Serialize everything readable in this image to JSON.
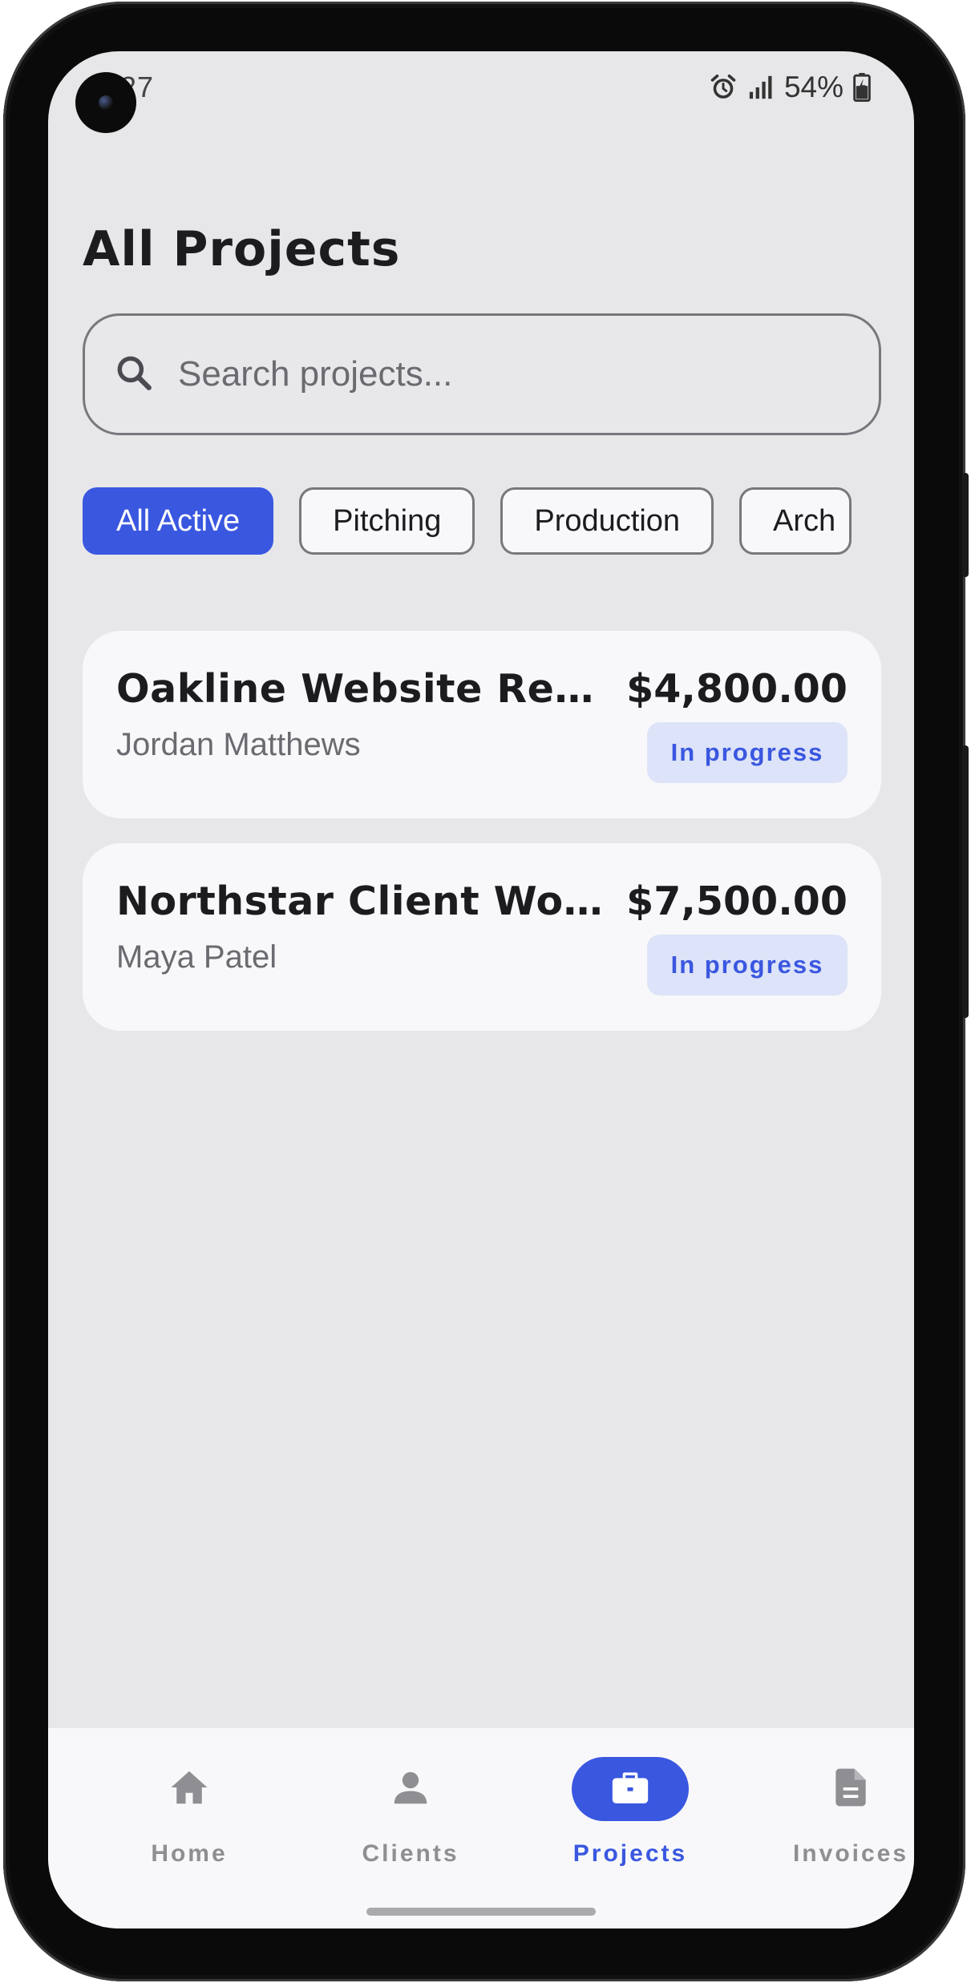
{
  "status_bar": {
    "time": "9:27",
    "battery": "54%"
  },
  "page": {
    "title": "All Projects"
  },
  "search": {
    "placeholder": "Search projects..."
  },
  "filters": [
    {
      "label": "All Active",
      "selected": true
    },
    {
      "label": "Pitching",
      "selected": false
    },
    {
      "label": "Production",
      "selected": false
    },
    {
      "label": "Arch",
      "selected": false
    }
  ],
  "projects": [
    {
      "title": "Oakline Website Refresh",
      "client": "Jordan Matthews",
      "amount": "$4,800.00",
      "status": "In progress"
    },
    {
      "title": "Northstar Client Work...",
      "client": "Maya Patel",
      "amount": "$7,500.00",
      "status": "In progress"
    }
  ],
  "nav": {
    "items": [
      {
        "label": "Home",
        "icon": "home-icon",
        "active": false
      },
      {
        "label": "Clients",
        "icon": "person-icon",
        "active": false
      },
      {
        "label": "Projects",
        "icon": "briefcase-icon",
        "active": true
      },
      {
        "label": "Invoices",
        "icon": "document-icon",
        "active": false
      }
    ]
  },
  "colors": {
    "accent": "#3a57e0",
    "background": "#e7e7ea",
    "card": "#f8f8fa",
    "badge_bg": "#dde3f8"
  }
}
